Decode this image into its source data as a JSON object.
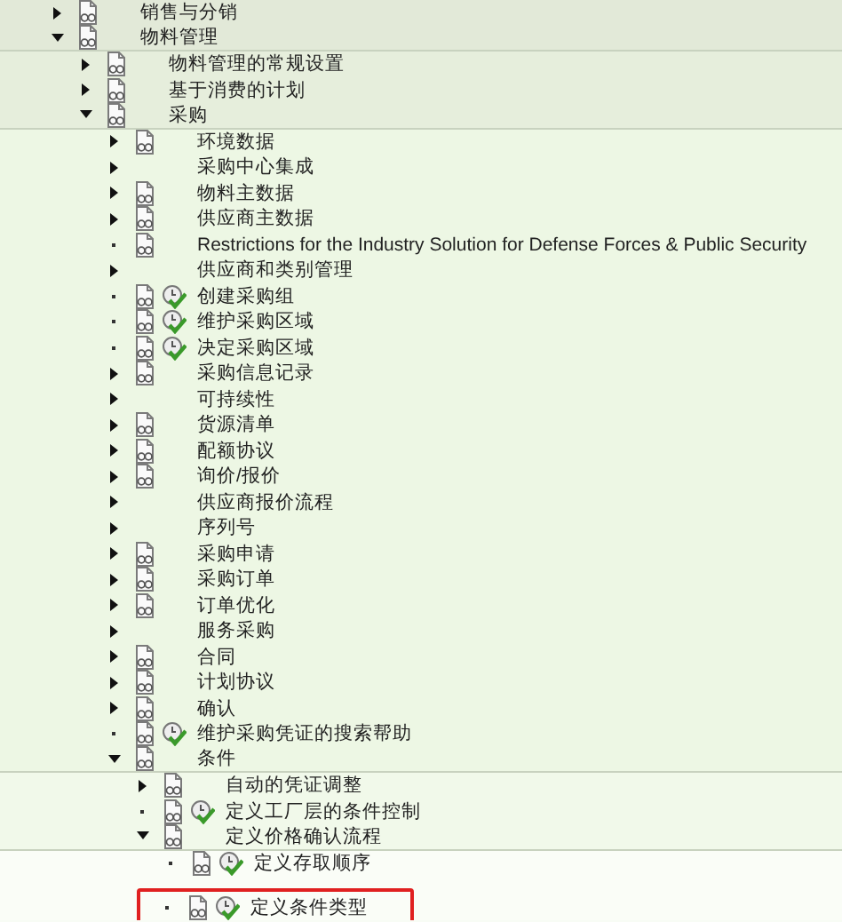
{
  "tree": [
    {
      "label": "销售与分销",
      "kind": "folder",
      "expanded": false,
      "doc": true,
      "clock": false
    },
    {
      "label": "物料管理",
      "kind": "folder",
      "expanded": true,
      "doc": true,
      "clock": false,
      "children": [
        {
          "label": "物料管理的常规设置",
          "kind": "folder",
          "expanded": false,
          "doc": true,
          "clock": false
        },
        {
          "label": "基于消费的计划",
          "kind": "folder",
          "expanded": false,
          "doc": true,
          "clock": false
        },
        {
          "label": "采购",
          "kind": "folder",
          "expanded": true,
          "doc": true,
          "clock": false,
          "children": [
            {
              "label": "环境数据",
              "kind": "folder",
              "expanded": false,
              "doc": true,
              "clock": false
            },
            {
              "label": "采购中心集成",
              "kind": "folder",
              "expanded": false,
              "doc": false,
              "clock": false
            },
            {
              "label": "物料主数据",
              "kind": "folder",
              "expanded": false,
              "doc": true,
              "clock": false
            },
            {
              "label": "供应商主数据",
              "kind": "folder",
              "expanded": false,
              "doc": true,
              "clock": false
            },
            {
              "label": "Restrictions for the Industry Solution for Defense Forces & Public Security",
              "kind": "activity",
              "doc": true,
              "clock": false
            },
            {
              "label": "供应商和类别管理",
              "kind": "folder",
              "expanded": false,
              "doc": false,
              "clock": false
            },
            {
              "label": "创建采购组",
              "kind": "activity",
              "doc": true,
              "clock": true
            },
            {
              "label": "维护采购区域",
              "kind": "activity",
              "doc": true,
              "clock": true
            },
            {
              "label": "决定采购区域",
              "kind": "activity",
              "doc": true,
              "clock": true
            },
            {
              "label": "采购信息记录",
              "kind": "folder",
              "expanded": false,
              "doc": true,
              "clock": false
            },
            {
              "label": "可持续性",
              "kind": "folder",
              "expanded": false,
              "doc": false,
              "clock": false
            },
            {
              "label": "货源清单",
              "kind": "folder",
              "expanded": false,
              "doc": true,
              "clock": false
            },
            {
              "label": "配额协议",
              "kind": "folder",
              "expanded": false,
              "doc": true,
              "clock": false
            },
            {
              "label": "询价/报价",
              "kind": "folder",
              "expanded": false,
              "doc": true,
              "clock": false
            },
            {
              "label": "供应商报价流程",
              "kind": "folder",
              "expanded": false,
              "doc": false,
              "clock": false
            },
            {
              "label": "序列号",
              "kind": "folder",
              "expanded": false,
              "doc": false,
              "clock": false
            },
            {
              "label": "采购申请",
              "kind": "folder",
              "expanded": false,
              "doc": true,
              "clock": false
            },
            {
              "label": "采购订单",
              "kind": "folder",
              "expanded": false,
              "doc": true,
              "clock": false
            },
            {
              "label": "订单优化",
              "kind": "folder",
              "expanded": false,
              "doc": true,
              "clock": false
            },
            {
              "label": "服务采购",
              "kind": "folder",
              "expanded": false,
              "doc": false,
              "clock": false
            },
            {
              "label": "合同",
              "kind": "folder",
              "expanded": false,
              "doc": true,
              "clock": false
            },
            {
              "label": "计划协议",
              "kind": "folder",
              "expanded": false,
              "doc": true,
              "clock": false
            },
            {
              "label": "确认",
              "kind": "folder",
              "expanded": false,
              "doc": true,
              "clock": false
            },
            {
              "label": "维护采购凭证的搜索帮助",
              "kind": "activity",
              "doc": true,
              "clock": true
            },
            {
              "label": "条件",
              "kind": "folder",
              "expanded": true,
              "doc": true,
              "clock": false,
              "children": [
                {
                  "label": "自动的凭证调整",
                  "kind": "folder",
                  "expanded": false,
                  "doc": true,
                  "clock": false
                },
                {
                  "label": "定义工厂层的条件控制",
                  "kind": "activity",
                  "doc": true,
                  "clock": true
                },
                {
                  "label": "定义价格确认流程",
                  "kind": "folder",
                  "expanded": true,
                  "doc": true,
                  "clock": false,
                  "children": [
                    {
                      "label": "定义存取顺序",
                      "kind": "activity",
                      "doc": true,
                      "clock": true,
                      "highlighted": false
                    },
                    {
                      "label": "定义条件类型",
                      "kind": "activity",
                      "doc": true,
                      "clock": true,
                      "highlighted": true
                    }
                  ]
                }
              ]
            }
          ]
        }
      ]
    }
  ]
}
